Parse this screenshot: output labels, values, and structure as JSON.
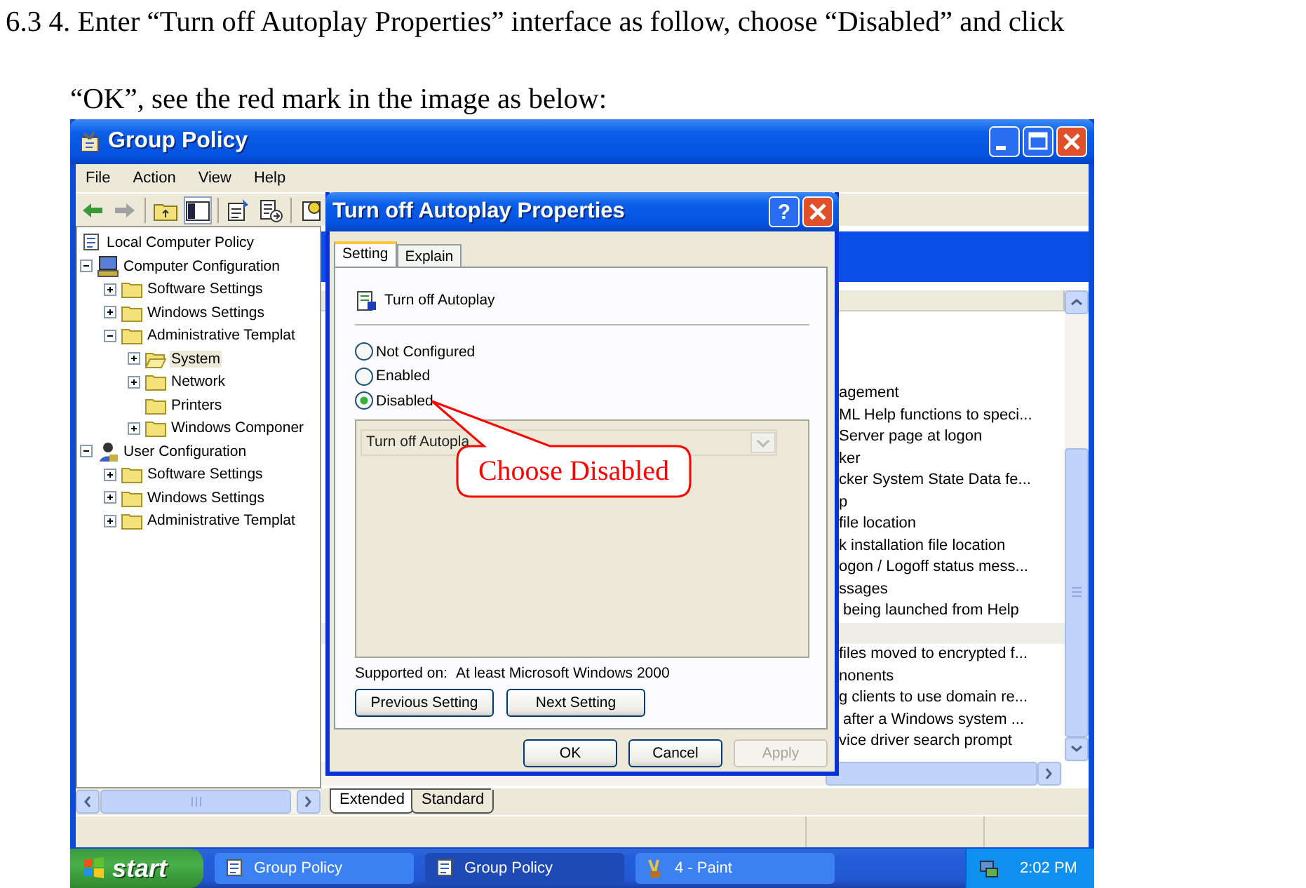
{
  "instruction": "6.3 4. Enter “Turn off Autoplay Properties” interface as follow, choose “Disabled” and click\n“OK”, see the red mark in the image as below:",
  "window": {
    "title": "Group Policy"
  },
  "menu": [
    "File",
    "Action",
    "View",
    "Help"
  ],
  "tree": [
    {
      "label": "Local Computer Policy",
      "kind": "policy",
      "selected": false,
      "children": [
        {
          "label": "Computer Configuration",
          "kind": "computer",
          "expanded": true,
          "selected": false,
          "children": [
            {
              "label": "Software Settings",
              "kind": "folder",
              "expanded": false,
              "selected": false
            },
            {
              "label": "Windows Settings",
              "kind": "folder",
              "expanded": false,
              "selected": false
            },
            {
              "label": "Administrative Templat",
              "kind": "folder",
              "expanded": true,
              "selected": false,
              "children": [
                {
                  "label": "System",
                  "kind": "open-folder",
                  "expanded": false,
                  "selected": true
                },
                {
                  "label": "Network",
                  "kind": "folder",
                  "expanded": false,
                  "selected": false
                },
                {
                  "label": "Printers",
                  "kind": "folder",
                  "selected": false
                },
                {
                  "label": "Windows Componer",
                  "kind": "folder",
                  "expanded": false,
                  "selected": false
                }
              ]
            }
          ]
        },
        {
          "label": "User Configuration",
          "kind": "user",
          "expanded": true,
          "selected": false,
          "children": [
            {
              "label": "Software Settings",
              "kind": "folder",
              "expanded": false,
              "selected": false
            },
            {
              "label": "Windows Settings",
              "kind": "folder",
              "expanded": false,
              "selected": false
            },
            {
              "label": "Administrative Templat",
              "kind": "folder",
              "expanded": false,
              "selected": false
            }
          ]
        }
      ]
    }
  ],
  "list": {
    "row_groups": [
      [
        "agement",
        "ML Help functions to speci...",
        "Server page at logon",
        "ker",
        "cker System State Data fe...",
        "p",
        "file location",
        "k installation file location",
        "ogon / Logoff status mess...",
        "ssages",
        " being launched from Help"
      ],
      [
        "files moved to encrypted f...",
        "nonents",
        "g clients to use domain re...",
        " after a Windows system ...",
        "vice driver search prompt"
      ]
    ]
  },
  "view_tabs": [
    {
      "label": "Extended",
      "selected": true
    },
    {
      "label": "Standard",
      "selected": false
    }
  ],
  "dialog": {
    "title": "Turn off Autoplay Properties",
    "help_button": "?",
    "tabs": [
      {
        "label": "Setting",
        "selected": true
      },
      {
        "label": "Explain",
        "selected": false
      }
    ],
    "policy": "Turn off Autoplay",
    "options": [
      {
        "label": "Not Configured",
        "selected": false
      },
      {
        "label": "Enabled",
        "selected": false
      },
      {
        "label": "Disabled",
        "selected": true
      }
    ],
    "combo_value": "Turn off Autopla",
    "supported_label": "Supported on:",
    "supported_value": "At least Microsoft Windows 2000",
    "nav_buttons": [
      "Previous Setting",
      "Next Setting"
    ],
    "buttons": [
      {
        "label": "OK",
        "disabled": false
      },
      {
        "label": "Cancel",
        "disabled": false
      },
      {
        "label": "Apply",
        "disabled": true
      }
    ]
  },
  "callout": {
    "text": "Choose Disabled"
  },
  "taskbar": {
    "start": "start",
    "buttons": [
      {
        "label": "Group Policy",
        "kind": "policy",
        "selected": false
      },
      {
        "label": "Group Policy",
        "kind": "policy",
        "selected": true
      },
      {
        "label": "4 - Paint",
        "kind": "paint",
        "selected": false
      }
    ],
    "clock": "2:02 PM"
  }
}
